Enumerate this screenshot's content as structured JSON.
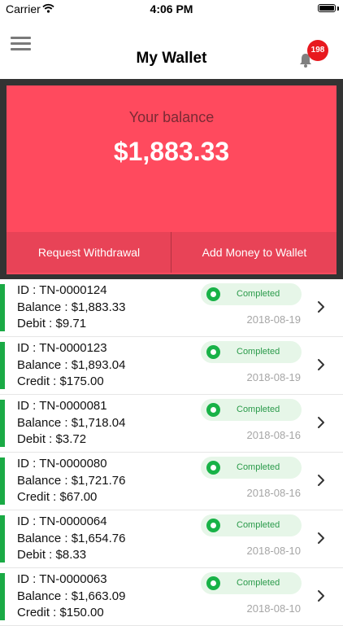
{
  "status_bar": {
    "carrier": "Carrier",
    "time": "4:06 PM"
  },
  "nav": {
    "title": "My Wallet",
    "notification_count": "198",
    "menu_icon": "hamburger-icon",
    "bell_icon": "bell-icon"
  },
  "balance": {
    "label": "Your balance",
    "amount": "$1,883.33",
    "request_withdrawal_label": "Request Withdrawal",
    "add_money_label": "Add Money to Wallet"
  },
  "colors": {
    "accent": "#ff4a5e",
    "status_green": "#1aaa45"
  },
  "transactions": [
    {
      "id": "ID : TN-0000124",
      "balance": "Balance : $1,883.33",
      "amount": "Debit : $9.71",
      "status": "Completed",
      "date": "2018-08-19"
    },
    {
      "id": "ID : TN-0000123",
      "balance": "Balance : $1,893.04",
      "amount": "Credit : $175.00",
      "status": "Completed",
      "date": "2018-08-19"
    },
    {
      "id": "ID : TN-0000081",
      "balance": "Balance : $1,718.04",
      "amount": "Debit : $3.72",
      "status": "Completed",
      "date": "2018-08-16"
    },
    {
      "id": "ID : TN-0000080",
      "balance": "Balance : $1,721.76",
      "amount": "Credit : $67.00",
      "status": "Completed",
      "date": "2018-08-16"
    },
    {
      "id": "ID : TN-0000064",
      "balance": "Balance : $1,654.76",
      "amount": "Debit : $8.33",
      "status": "Completed",
      "date": "2018-08-10"
    },
    {
      "id": "ID : TN-0000063",
      "balance": "Balance : $1,663.09",
      "amount": "Credit : $150.00",
      "status": "Completed",
      "date": "2018-08-10"
    }
  ]
}
